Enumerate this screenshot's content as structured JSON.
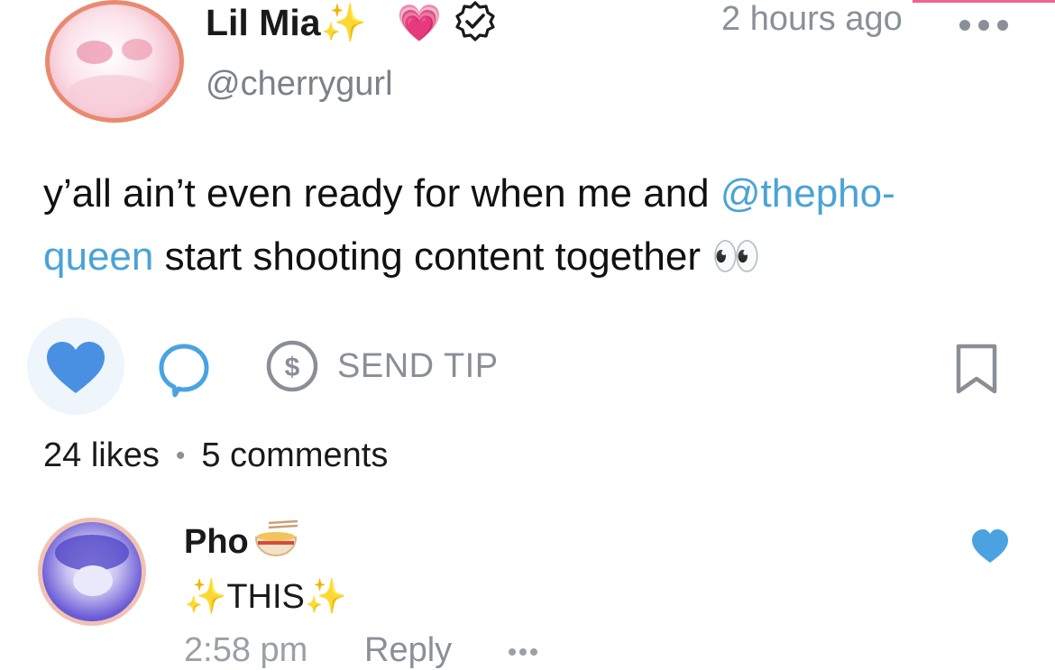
{
  "post": {
    "author_name": "Lil Mia",
    "name_emojis": "✨",
    "heart_emoji": "💗",
    "handle": "@cherrygurl",
    "time": "2 hours ago",
    "text_part1": "y’all ain’t even ready for when me and ",
    "mention": "@thepho-\nqueen",
    "text_part2": " start shooting content together ",
    "text_emoji": "👀",
    "send_tip_label": "SEND TIP",
    "likes": "24 likes",
    "comments": "5 comments",
    "stats_separator": "•"
  },
  "comment": {
    "author_name": "Pho",
    "name_emoji": "🍜",
    "text": "✨THIS✨",
    "time": "2:58 pm",
    "reply_label": "Reply"
  },
  "colors": {
    "accent_blue": "#4a90e2",
    "mention_blue": "#4aa3d6",
    "muted_gray": "#8a9097",
    "avatar_ring_post": "#e88a70",
    "avatar_ring_comment": "#f1c2b4",
    "top_accent": "#f06292"
  },
  "icons": {
    "verified": "verified-badge-icon",
    "more": "more-dots-icon",
    "like": "heart-icon",
    "comment": "comment-bubble-icon",
    "tip": "dollar-coin-icon",
    "bookmark": "bookmark-icon"
  }
}
